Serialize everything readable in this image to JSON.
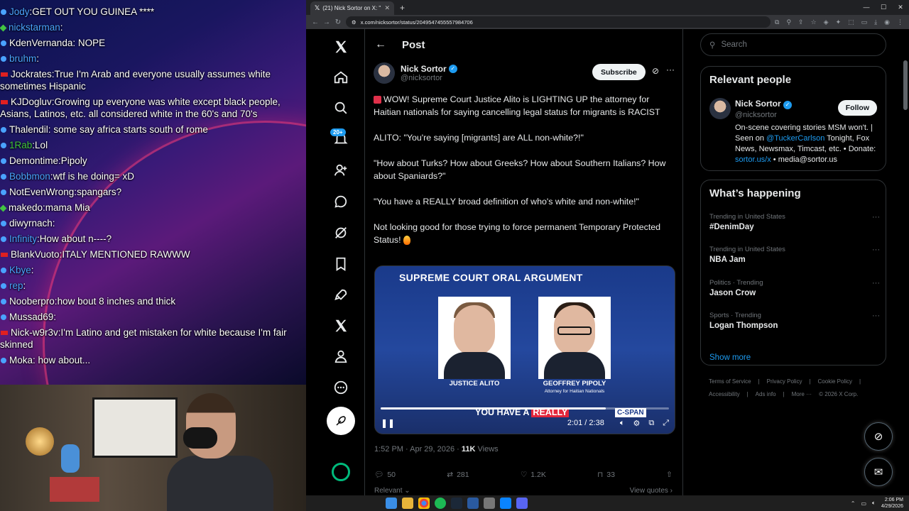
{
  "chat": {
    "messages": [
      {
        "user": "Jody",
        "text": "GET OUT YOU GUINEA ****",
        "color": "#4aa3ff",
        "badge": "blue"
      },
      {
        "user": "nickstarman",
        "text": "",
        "color": "#4aa3ff",
        "badge": "green"
      },
      {
        "user": "KdenVernanda",
        "text": " NOPE",
        "color": "#ffffff",
        "badge": "blue"
      },
      {
        "user": "bruhm",
        "text": "",
        "color": "#4aa3ff",
        "badge": "blue"
      },
      {
        "user": "Jockrates",
        "text": "True I'm Arab and everyone usually assumes white sometimes Hispanic",
        "color": "#ffffff",
        "badge": "red"
      },
      {
        "user": "KJDogluv",
        "text": "Growing up everyone was white except black people, Asians, Latinos, etc. all considered white in the 60's and 70's",
        "color": "#ffffff",
        "badge": "red"
      },
      {
        "user": "Thalendil",
        "text": " some say africa starts south of rome",
        "color": "#ffffff",
        "badge": "blue"
      },
      {
        "user": "1Rab",
        "text": "Lol",
        "color": "#42c442",
        "badge": "blue"
      },
      {
        "user": "Demontime",
        "text": "Pipoly",
        "color": "#ffffff",
        "badge": "blue"
      },
      {
        "user": "Bobbmon",
        "text": "wtf is he doing= xD",
        "color": "#4aa3ff",
        "badge": "blue"
      },
      {
        "user": "NotEvenWrong",
        "text": "spangars?",
        "color": "#ffffff",
        "badge": "blue"
      },
      {
        "user": "makedo",
        "text": "mama Mia",
        "color": "#ffffff",
        "badge": "green"
      },
      {
        "user": "diwyrnach",
        "text": "",
        "color": "#ffffff",
        "badge": "blue"
      },
      {
        "user": "Infinity",
        "text": "How about n----?",
        "color": "#4aa3ff",
        "badge": "blue"
      },
      {
        "user": "BlankVuoto",
        "text": "ITALY MENTIONED RAWWW",
        "color": "#ffffff",
        "badge": "red"
      },
      {
        "user": "Kbye",
        "text": "",
        "color": "#4aa3ff",
        "badge": "blue"
      },
      {
        "user": "rep",
        "text": "",
        "color": "#4aa3ff",
        "badge": "blue"
      },
      {
        "user": "Nooberpro",
        "text": "how bout 8 inches and thick",
        "color": "#ffffff",
        "badge": "blue"
      },
      {
        "user": "Mussad69",
        "text": "",
        "color": "#ffffff",
        "badge": "blue"
      },
      {
        "user": "Nick-w9r3v",
        "text": "I'm Latino and get mistaken for white because I'm fair skinned",
        "color": "#ffffff",
        "badge": "red"
      },
      {
        "user": "Moka",
        "text": " how about...",
        "color": "#ffffff",
        "badge": "blue"
      }
    ]
  },
  "browser": {
    "tab_title": "(21) Nick Sortor on X: \"🚨 WOW",
    "url": "x.com/nicksortor/status/2049547455557984706"
  },
  "x": {
    "notif_count": "20+",
    "header_title": "Post",
    "author_name": "Nick Sortor",
    "author_handle": "@nicksortor",
    "subscribe_label": "Subscribe",
    "post_paragraphs": [
      "WOW! Supreme Court Justice Alito is LIGHTING UP the attorney for Haitian nationals for saying cancelling legal status for migrants is RACIST",
      "ALITO: \"You're saying [migrants] are ALL non-white?!\"",
      "\"How about Turks? How about Greeks? How about Southern Italians? How about Spaniards?\"",
      "\"You have a REALLY broad definition of who's white and non-white!\"",
      "Not looking good for those trying to force permanent Temporary Protected Status!"
    ],
    "video": {
      "title": "SUPREME COURT ORAL ARGUMENT",
      "left_name": "JUSTICE ALITO",
      "right_name": "GEOFFREY PIPOLY",
      "right_sub": "Attorney for Haitian Nationals",
      "caption_prefix": "YOU HAVE A ",
      "caption_highlight": "REALLY",
      "network": "C-SPAN",
      "time": "2:01 / 2:38",
      "progress": 0.78
    },
    "post_time": "1:52 PM · Apr 29, 2026 · ",
    "views_count": "11K",
    "views_label": " Views",
    "replies": "50",
    "reposts": "281",
    "likes": "1.2K",
    "bookmarks": "33",
    "relevant_label": "Relevant ⌄",
    "view_quotes": "View quotes ›",
    "search_placeholder": "Search",
    "relevant_people_title": "Relevant people",
    "rp_name": "Nick Sortor",
    "rp_handle": "@nicksortor",
    "follow_label": "Follow",
    "bio_part1": "On-scene covering stories MSM won't. | Seen on ",
    "bio_link1": "@TuckerCarlson",
    "bio_part2": " Tonight, Fox News, Newsmax, Timcast, etc. • Donate: ",
    "bio_link2": "sortor.us/x",
    "bio_part3": " • media@sortor.us",
    "happening_title": "What’s happening",
    "trends": [
      {
        "context": "Trending in United States",
        "name": "#DenimDay"
      },
      {
        "context": "Trending in United States",
        "name": "NBA Jam"
      },
      {
        "context": "Politics · Trending",
        "name": "Jason Crow"
      },
      {
        "context": "Sports · Trending",
        "name": "Logan Thompson"
      }
    ],
    "show_more": "Show more",
    "footer_links": [
      "Terms of Service",
      "|",
      "Privacy Policy",
      "|",
      "Cookie Policy",
      "|",
      "Accessibility",
      "|",
      "Ads info",
      "|",
      "More ···",
      "© 2026 X Corp."
    ]
  },
  "taskbar": {
    "time": "2:06 PM",
    "date": "4/29/2026"
  }
}
